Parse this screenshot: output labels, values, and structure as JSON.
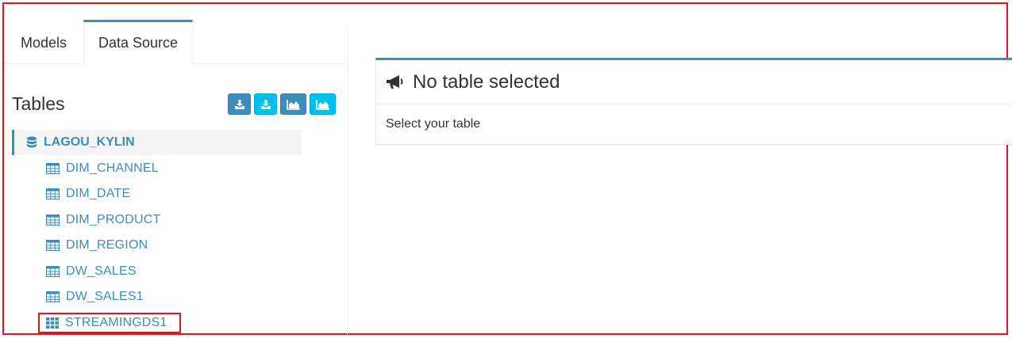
{
  "tabs": [
    {
      "label": "Models",
      "active": false
    },
    {
      "label": "Data Source",
      "active": true
    }
  ],
  "sidebar": {
    "title": "Tables",
    "toolbar": [
      {
        "icon": "download-icon",
        "style": "dark"
      },
      {
        "icon": "download-icon",
        "style": "light"
      },
      {
        "icon": "area-chart-icon",
        "style": "dark"
      },
      {
        "icon": "area-chart-icon",
        "style": "light"
      }
    ],
    "database": {
      "icon": "database-icon",
      "label": "LAGOU_KYLIN"
    },
    "tables": [
      {
        "label": "DIM_CHANNEL",
        "icon": "table-icon"
      },
      {
        "label": "DIM_DATE",
        "icon": "table-icon"
      },
      {
        "label": "DIM_PRODUCT",
        "icon": "table-icon"
      },
      {
        "label": "DIM_REGION",
        "icon": "table-icon"
      },
      {
        "label": "DW_SALES",
        "icon": "table-icon"
      },
      {
        "label": "DW_SALES1",
        "icon": "table-icon"
      },
      {
        "label": "STREAMINGDS1",
        "icon": "grid-icon",
        "highlighted": true
      }
    ]
  },
  "main": {
    "panel_icon": "bullhorn-icon",
    "panel_title": "No table selected",
    "panel_body": "Select your table"
  },
  "colors": {
    "accent": "#3c8dbc",
    "accent_light": "#00c0ef",
    "highlight_border": "#e2141c"
  }
}
